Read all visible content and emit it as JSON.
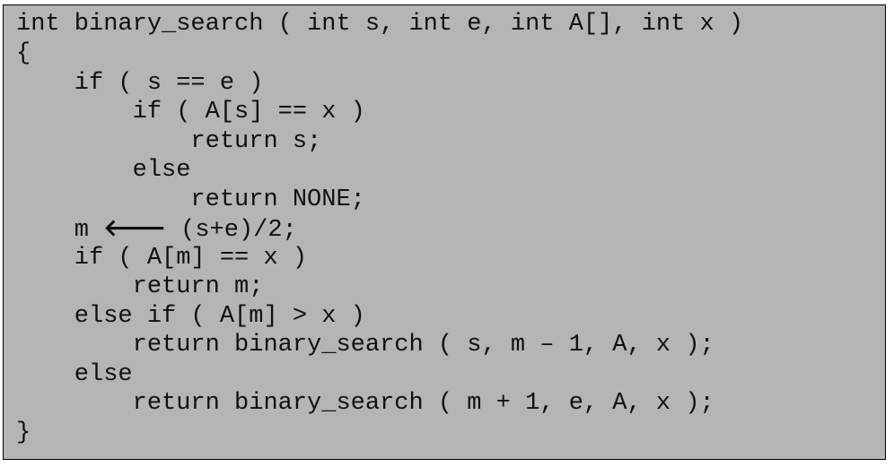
{
  "code": {
    "lines": [
      "int binary_search ( int s, int e, int A[], int x )",
      "{",
      "    if ( s == e )",
      "        if ( A[s] == x )",
      "            return s;",
      "        else",
      "            return NONE;",
      "    m ",
      "    if ( A[m] == x )",
      "        return m;",
      "    else if ( A[m] > x )",
      "        return binary_search ( s, m – 1, A, x );",
      "    else",
      "        return binary_search ( m + 1, e, A, x );",
      "}"
    ],
    "assign_arrow": "🡐",
    "assign_rhs": " (s+e)/2;"
  }
}
